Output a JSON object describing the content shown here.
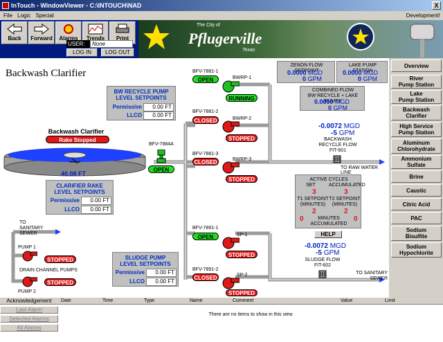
{
  "window": {
    "title": "InTouch - WindowViewer - C:\\INTOUCH\\NAD",
    "close": "X"
  },
  "menu": {
    "file": "File",
    "logic": "Logic",
    "special": "Special",
    "development": "Development!"
  },
  "toolbar": {
    "back": "Back",
    "forward": "Forward",
    "alarms": "Alarms",
    "trends": "Trends",
    "print": "Print"
  },
  "banner": {
    "the_city_of": "The City of",
    "city": "Pflugerville",
    "state": "Texas"
  },
  "user": {
    "label": "USER:",
    "value": "None",
    "login": "LOG IN",
    "logout": "LOG OUT"
  },
  "page_title": "Backwash Clarifier",
  "flow_setpoints": {
    "zenon_label": "ZENON FLOW SETPOINT",
    "zenon_mgd": "0.0000",
    "zenon_gpm": "0",
    "lake_label": "LAKE PUMP STATION",
    "lake_mgd": "0.0000",
    "lake_gpm": "0",
    "combined_label": "COMBINED FLOW\nBW RECYCLE + LAKE PUMPS",
    "combined_mgd": "0.0000",
    "combined_gpm": "0",
    "mgd_unit": "MGD",
    "gpm_unit": "GPM"
  },
  "bw_recycle": {
    "title": "BW RECYCLE PUMP\nLEVEL SETPOINTS",
    "permissive_label": "Permissive",
    "permissive": "0.00 FT",
    "llco_label": "LLCO",
    "llco": "0.00 FT"
  },
  "clarifier": {
    "title": "Backwash Clarifier",
    "status": "Rake Stopped",
    "level": "40.08 FT"
  },
  "rake_setpoints": {
    "title": "CLARIFIER RAKE\nLEVEL SETPOINTS",
    "permissive_label": "Permissive",
    "permissive": "0.00 FT",
    "llco_label": "LLCO",
    "llco": "0.00 FT"
  },
  "sludge_setpoints": {
    "title": "SLUDGE PUMP\nLEVEL SETPOINTS",
    "permissive_label": "Permissive",
    "permissive": "0.00 FT",
    "llco_label": "LLCO",
    "llco": "0.00 FT"
  },
  "valves": [
    {
      "tag": "BFV-7884A",
      "state": "OPEN"
    },
    {
      "tag": "BFV-7881-1",
      "state": "OPEN"
    },
    {
      "tag": "BFV-7881-2",
      "state": "CLOSED"
    },
    {
      "tag": "BFV-7881-3",
      "state": "CLOSED"
    },
    {
      "tag": "BFV-7891-1",
      "state": "OPEN"
    },
    {
      "tag": "BFV-7891-2",
      "state": "CLOSED"
    }
  ],
  "pumps": [
    {
      "tag": "BWRP-1",
      "state": "RUNNING"
    },
    {
      "tag": "BWRP-2",
      "state": "STOPPED"
    },
    {
      "tag": "BWRP-3",
      "state": "STOPPED"
    },
    {
      "tag": "SP-1",
      "state": "STOPPED"
    },
    {
      "tag": "SP-2",
      "state": "STOPPED"
    }
  ],
  "drain": {
    "pump1": "PUMP 1",
    "pump1_state": "STOPPED",
    "pump2": "PUMP 2",
    "pump2_state": "STOPPED",
    "label": "DRAIN CHANNEL PUMPS",
    "to_sewer": "TO\nSANITARY\nSEWER"
  },
  "backwash_flow": {
    "mgd": "-0.0072",
    "gpm": "-5",
    "mgd_unit": "MGD",
    "gpm_unit": "GPM",
    "label": "BACKWASH\nRECYCLE FLOW\nFIT-601",
    "to_raw": "TO RAW WATER LINE"
  },
  "cycles": {
    "active_label": "ACTIVE CYCLES",
    "set_label": "SET",
    "set": "3",
    "accum_label": "ACCUMULATED",
    "accum": "3",
    "t1_label": "T1 SETPOINT\n(MINUTES)",
    "t1": "2",
    "t2_label": "T2 SETPOINT\n(MINUTES)",
    "t2": "2",
    "min_accum_value_left": "0",
    "min_accum_label": "MINUTES\nACCUMULATED",
    "min_accum_value_right": "0",
    "help": "HELP"
  },
  "sludge_flow": {
    "mgd": "-0.0072",
    "gpm": "-5",
    "mgd_unit": "MGD",
    "gpm_unit": "GPM",
    "label": "SLUDGE FLOW\nFIT-602",
    "to_sewer": "TO SANITARY\nSEWER"
  },
  "nav": [
    "Overview",
    "River\nPump Station",
    "Lake\nPump Station",
    "Backwash\nClarifier",
    "High Service\nPump Station",
    "Aluminum\nChlorohydrate",
    "Ammonium\nSulfate",
    "Brine",
    "Caustic",
    "Citric Acid",
    "PAC",
    "Sodium\nBisulfite",
    "Sodium\nHypochlorite"
  ],
  "alarms": {
    "acknowledgement": "Acknowledgement",
    "last": "Last Alarm",
    "selected": "Selected Alarms",
    "all": "All Alarms",
    "columns": [
      "Date",
      "Time",
      "Type",
      "Name",
      "Comment",
      "Value",
      "Limit"
    ],
    "empty": "There are no items to show in this view"
  },
  "colors": {
    "accent_green": "#20e020",
    "accent_red": "#e01818",
    "value_blue": "#0020c0",
    "water_blue": "#1e40ff"
  }
}
